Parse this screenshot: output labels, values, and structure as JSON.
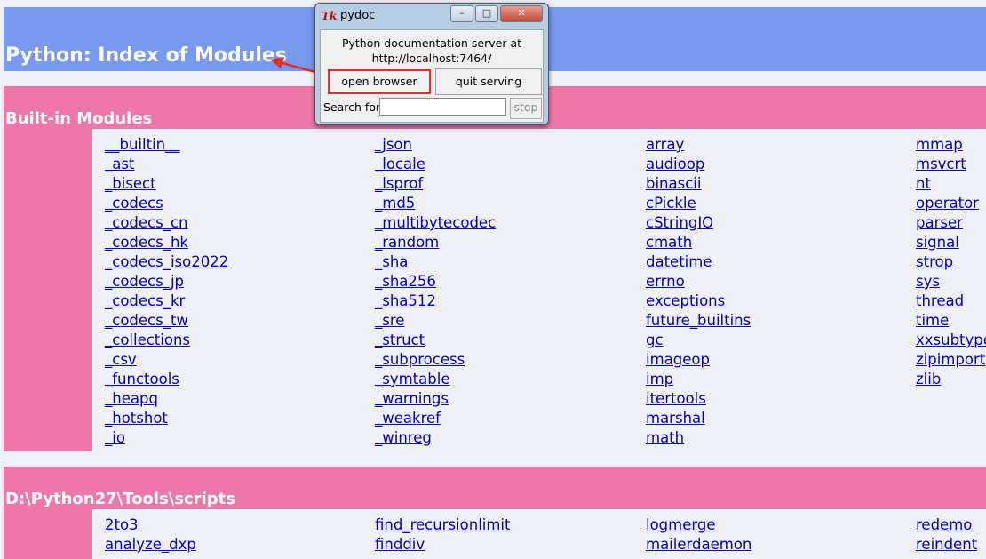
{
  "page": {
    "title": "Python: Index of Modules"
  },
  "builtin": {
    "title": "Built-in Modules",
    "columns": [
      [
        "__builtin__",
        "_ast",
        "_bisect",
        "_codecs",
        "_codecs_cn",
        "_codecs_hk",
        "_codecs_iso2022",
        "_codecs_jp",
        "_codecs_kr",
        "_codecs_tw",
        "_collections",
        "_csv",
        "_functools",
        "_heapq",
        "_hotshot",
        "_io"
      ],
      [
        "_json",
        "_locale",
        "_lsprof",
        "_md5",
        "_multibytecodec",
        "_random",
        "_sha",
        "_sha256",
        "_sha512",
        "_sre",
        "_struct",
        "_subprocess",
        "_symtable",
        "_warnings",
        "_weakref",
        "_winreg"
      ],
      [
        "array",
        "audioop",
        "binascii",
        "cPickle",
        "cStringIO",
        "cmath",
        "datetime",
        "errno",
        "exceptions",
        "future_builtins",
        "gc",
        "imageop",
        "imp",
        "itertools",
        "marshal",
        "math"
      ],
      [
        "mmap",
        "msvcrt",
        "nt",
        "operator",
        "parser",
        "signal",
        "strop",
        "sys",
        "thread",
        "time",
        "xxsubtype",
        "zipimport",
        "zlib"
      ]
    ]
  },
  "scripts": {
    "title": "D:\\Python27\\Tools\\scripts",
    "columns": [
      [
        "2to3",
        "analyze_dxp"
      ],
      [
        "find_recursionlimit",
        "finddiv"
      ],
      [
        "logmerge",
        "mailerdaemon"
      ],
      [
        "redemo",
        "reindent"
      ]
    ]
  },
  "pydoc_window": {
    "title": "pydoc",
    "logo": "Tk",
    "message_line1": "Python documentation server at",
    "message_line2": "http://localhost:7464/",
    "open_button": "open browser",
    "quit_button": "quit serving",
    "search_label": "Search for",
    "search_value": "",
    "stop_button": "stop",
    "minimize": "–",
    "maximize": "□",
    "close": "✕"
  },
  "colors": {
    "header": "#7799ee",
    "section": "#ee77aa",
    "background": "#f0f0f8",
    "link": "#0000bb",
    "highlight": "#e0302a"
  }
}
